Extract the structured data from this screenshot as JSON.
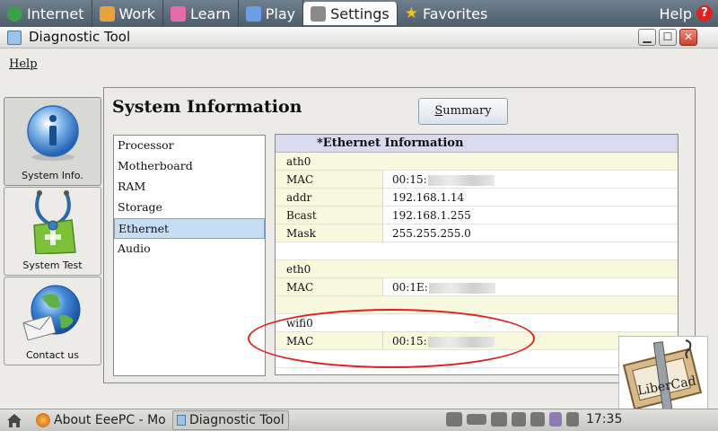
{
  "top_tabs": [
    {
      "label": "Internet",
      "icon": "globe-icon",
      "color": "#3aa04a"
    },
    {
      "label": "Work",
      "icon": "briefcase-icon",
      "color": "#e8a23a"
    },
    {
      "label": "Learn",
      "icon": "book-icon",
      "color": "#e86aa8"
    },
    {
      "label": "Play",
      "icon": "gamepad-icon",
      "color": "#6aa0e8"
    },
    {
      "label": "Settings",
      "icon": "wrench-icon",
      "color": "#8a8a8a",
      "active": true
    },
    {
      "label": "Favorites",
      "icon": "star-icon",
      "color": "#f0c020"
    }
  ],
  "top_help": "Help",
  "window": {
    "title": "Diagnostic Tool",
    "menu_help": "Help",
    "controls": {
      "minimize": "minimize-icon",
      "maximize": "maximize-icon",
      "close": "close-icon"
    }
  },
  "sidebar": [
    {
      "label": "System Info.",
      "icon": "info-icon",
      "active": true
    },
    {
      "label": "System Test",
      "icon": "stethoscope-icon"
    },
    {
      "label": "Contact us",
      "icon": "globe-mail-icon"
    }
  ],
  "main": {
    "title": "System Information",
    "summary_button": {
      "underlined": "S",
      "rest": "ummary"
    },
    "categories": [
      "Processor",
      "Motherboard",
      "RAM",
      "Storage",
      "Ethernet",
      "Audio"
    ],
    "selected_category": "Ethernet",
    "info_header": "*Ethernet Information",
    "sections": [
      {
        "group": "ath0",
        "rows": [
          {
            "key": "MAC",
            "value": "00:15:",
            "redacted": true
          },
          {
            "key": "addr",
            "value": "192.168.1.14"
          },
          {
            "key": "Bcast",
            "value": "192.168.1.255"
          },
          {
            "key": "Mask",
            "value": "255.255.255.0"
          }
        ]
      },
      {
        "group": "eth0",
        "rows": [
          {
            "key": "MAC",
            "value": "00:1E:",
            "redacted": true
          }
        ]
      },
      {
        "group": "wifi0",
        "rows": [
          {
            "key": "MAC",
            "value": "00:15:",
            "redacted": true
          }
        ]
      }
    ]
  },
  "watermark_text": "LiberCad",
  "taskbar": {
    "tasks": [
      {
        "label": "About EeePC - Mo",
        "icon": "firefox-icon"
      },
      {
        "label": "Diagnostic Tool",
        "icon": "diag-app-icon",
        "active": true
      }
    ],
    "tray_icons": [
      "network-icon",
      "battery-icon",
      "wifi-icon",
      "keyboard-icon",
      "font-icon",
      "pen-icon",
      "volume-icon"
    ],
    "clock": "17:35"
  },
  "colors": {
    "annotation": "#e0201e",
    "selection": "#c7ddf3",
    "group_row": "#f8f8de"
  }
}
